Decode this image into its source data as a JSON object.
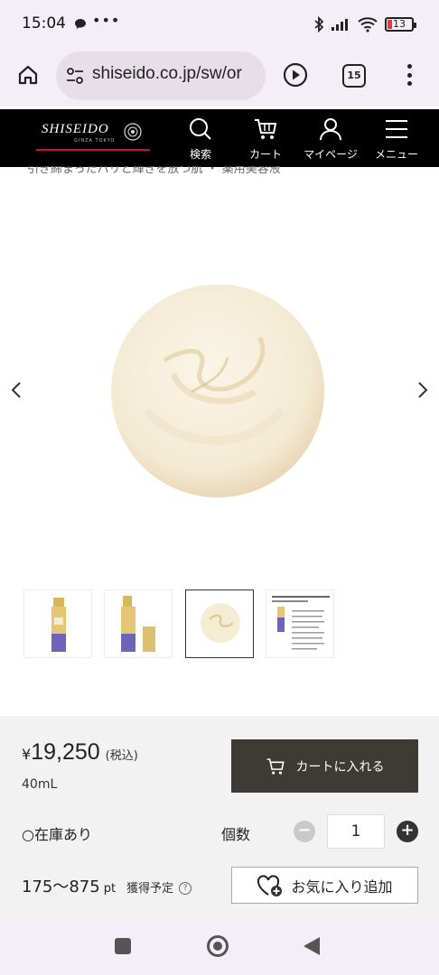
{
  "status_bar": {
    "time": "15:04",
    "more": "•••",
    "battery": "13"
  },
  "browser": {
    "url": "shiseido.co.jp/sw/or",
    "tab_count": "15"
  },
  "site_header": {
    "brand": "SHISEIDO",
    "brand_sub": "GINZA TOKYO",
    "nav": [
      {
        "label": "検索",
        "icon": "search-icon"
      },
      {
        "label": "カート",
        "icon": "cart-icon"
      },
      {
        "label": "マイページ",
        "icon": "person-icon"
      },
      {
        "label": "メニュー",
        "icon": "hamburger-icon"
      }
    ]
  },
  "breadcrumb_partial": "引き締まったハリと輝きを放つ肌  ・  薬用美容液",
  "gallery": {
    "thumbnails": [
      "product-bottle",
      "product-bottle-open",
      "cream-texture",
      "product-info-sheet"
    ],
    "selected_index": 2
  },
  "purchase": {
    "price": "19,250",
    "currency": "¥",
    "tax_label": "(税込)",
    "volume": "40mL",
    "cart_button": "カートに入れる",
    "stock": "○在庫あり",
    "qty_label": "個数",
    "qty_value": "1",
    "points": "175〜875",
    "points_unit": "pt",
    "points_label": "獲得予定",
    "favorite_button": "お気に入り追加"
  },
  "colors": {
    "header_bg": "#000000",
    "accent_red": "#c8102e",
    "cart_button_bg": "#3e3a35",
    "panel_bg": "#f2f2f2",
    "chrome_bg": "#f4eef6"
  }
}
